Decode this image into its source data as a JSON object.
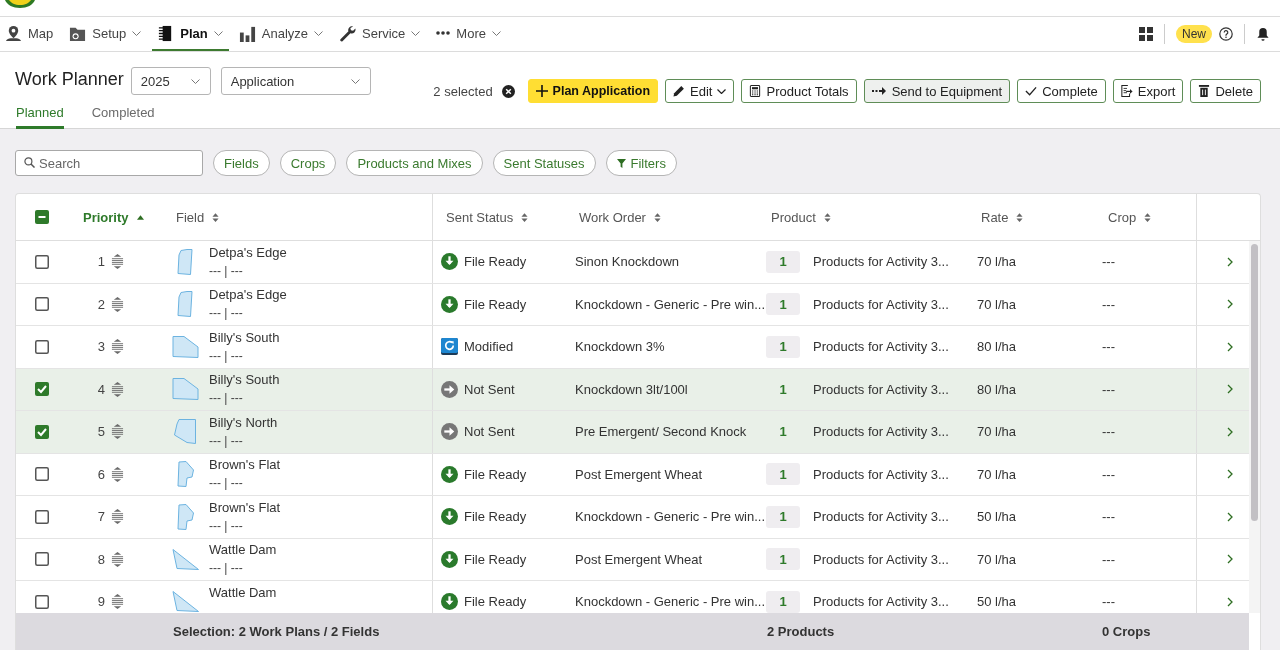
{
  "nav": {
    "items": [
      {
        "label": "Map",
        "menu": false,
        "selected": false
      },
      {
        "label": "Setup",
        "menu": true,
        "selected": false
      },
      {
        "label": "Plan",
        "menu": true,
        "selected": true
      },
      {
        "label": "Analyze",
        "menu": true,
        "selected": false
      },
      {
        "label": "Service",
        "menu": true,
        "selected": false
      },
      {
        "label": "More",
        "menu": true,
        "selected": false
      }
    ],
    "badge": "New"
  },
  "header": {
    "title": "Work Planner",
    "year_select": {
      "value": "2025"
    },
    "type_select": {
      "value": "Application"
    },
    "selection": "2 selected",
    "actions": [
      {
        "label": "Plan Application",
        "kind": "primary",
        "menu": false
      },
      {
        "label": "Edit",
        "kind": "outline",
        "menu": true
      },
      {
        "label": "Product Totals",
        "kind": "outline",
        "menu": false
      },
      {
        "label": "Send to Equipment",
        "kind": "shaded",
        "menu": false
      },
      {
        "label": "Complete",
        "kind": "outline",
        "menu": false
      },
      {
        "label": "Export",
        "kind": "outline",
        "menu": false
      },
      {
        "label": "Delete",
        "kind": "outline",
        "menu": false
      }
    ]
  },
  "tabs": [
    {
      "label": "Planned",
      "selected": true
    },
    {
      "label": "Completed",
      "selected": false
    }
  ],
  "filters": {
    "search": {
      "placeholder": "Search"
    },
    "chips": [
      {
        "label": "Fields",
        "kind": "plain"
      },
      {
        "label": "Crops",
        "kind": "plain"
      },
      {
        "label": "Products and Mixes",
        "kind": "plain"
      },
      {
        "label": "Sent Statuses",
        "kind": "plain"
      },
      {
        "label": "Filters",
        "kind": "filter"
      }
    ]
  },
  "table": {
    "select_all": {
      "checked": false,
      "partial": true
    },
    "columns": [
      {
        "label": "Priority",
        "sorted": true
      },
      {
        "label": "Field",
        "sorted": false
      },
      {
        "label": "Sent Status",
        "sorted": false
      },
      {
        "label": "Work Order",
        "sorted": false
      },
      {
        "label": "Product",
        "sorted": false
      },
      {
        "label": "Rate",
        "sorted": false
      },
      {
        "label": "Crop",
        "sorted": false
      }
    ],
    "rows": [
      {
        "selected": false,
        "priority": "1",
        "field": "Detpa's Edge",
        "field_detail": "--- | ---",
        "status": {
          "kind": "file_ready",
          "label": "File Ready"
        },
        "work_order": "Sinon Knockdown",
        "product_count": "1",
        "product": "Products for Activity 3...",
        "rate": "70 l/ha",
        "crop": "---"
      },
      {
        "selected": false,
        "priority": "2",
        "field": "Detpa's Edge",
        "field_detail": "--- | ---",
        "status": {
          "kind": "file_ready",
          "label": "File Ready"
        },
        "work_order": "Knockdown - Generic - Pre win...",
        "product_count": "1",
        "product": "Products for Activity 3...",
        "rate": "70 l/ha",
        "crop": "---"
      },
      {
        "selected": false,
        "priority": "3",
        "field": "Billy's South",
        "field_detail": "--- | ---",
        "status": {
          "kind": "modified",
          "label": "Modified"
        },
        "work_order": "Knockdown 3%",
        "product_count": "1",
        "product": "Products for Activity 3...",
        "rate": "80 l/ha",
        "crop": "---"
      },
      {
        "selected": true,
        "priority": "4",
        "field": "Billy's South",
        "field_detail": "--- | ---",
        "status": {
          "kind": "not_sent",
          "label": "Not Sent"
        },
        "work_order": "Knockdown 3lt/100l",
        "product_count": "1",
        "product": "Products for Activity 3...",
        "rate": "80 l/ha",
        "crop": "---"
      },
      {
        "selected": true,
        "priority": "5",
        "field": "Billy's North",
        "field_detail": "--- | ---",
        "status": {
          "kind": "not_sent",
          "label": "Not Sent"
        },
        "work_order": "Pre Emergent/ Second Knock",
        "product_count": "1",
        "product": "Products for Activity 3...",
        "rate": "70 l/ha",
        "crop": "---"
      },
      {
        "selected": false,
        "priority": "6",
        "field": "Brown's Flat",
        "field_detail": "--- | ---",
        "status": {
          "kind": "file_ready",
          "label": "File Ready"
        },
        "work_order": "Post Emergent Wheat",
        "product_count": "1",
        "product": "Products for Activity 3...",
        "rate": "70 l/ha",
        "crop": "---"
      },
      {
        "selected": false,
        "priority": "7",
        "field": "Brown's Flat",
        "field_detail": "--- | ---",
        "status": {
          "kind": "file_ready",
          "label": "File Ready"
        },
        "work_order": "Knockdown - Generic - Pre win...",
        "product_count": "1",
        "product": "Products for Activity 3...",
        "rate": "50 l/ha",
        "crop": "---"
      },
      {
        "selected": false,
        "priority": "8",
        "field": "Wattle Dam",
        "field_detail": "--- | ---",
        "status": {
          "kind": "file_ready",
          "label": "File Ready"
        },
        "work_order": "Post Emergent Wheat",
        "product_count": "1",
        "product": "Products for Activity 3...",
        "rate": "70 l/ha",
        "crop": "---"
      },
      {
        "selected": false,
        "priority": "9",
        "field": "Wattle Dam",
        "status": {
          "kind": "file_ready",
          "label": "File Ready"
        },
        "work_order": "Knockdown - Generic - Pre win...",
        "product_count": "1",
        "product": "Products for Activity 3...",
        "rate": "50 l/ha",
        "crop": "---"
      }
    ],
    "footer": {
      "selection": "Selection: 2 Work Plans / 2 Fields",
      "products": "2 Products",
      "crops": "0 Crops"
    }
  }
}
